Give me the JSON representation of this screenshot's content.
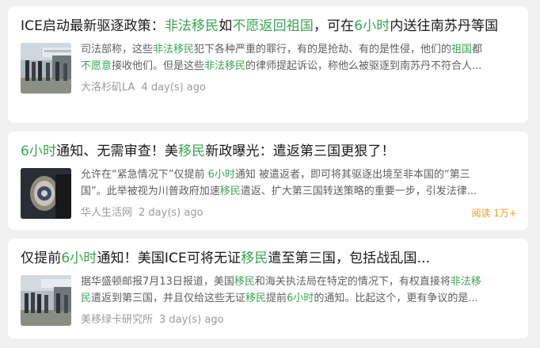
{
  "articles": [
    {
      "title_parts": [
        {
          "t": "ICE启动最新驱逐政策："
        },
        {
          "t": "非法移民",
          "h": true
        },
        {
          "t": "如"
        },
        {
          "t": "不愿返回祖国",
          "h": true
        },
        {
          "t": "，可在"
        },
        {
          "t": "6小时",
          "h": true
        },
        {
          "t": "内送往南苏丹等国"
        }
      ],
      "summary_line1": [
        {
          "t": "司法部称，这些"
        },
        {
          "t": "非法移民",
          "h": true
        },
        {
          "t": "犯下各种严重的罪行，有的是抢劫、有的是性侵，他们的"
        },
        {
          "t": "祖国",
          "h": true
        },
        {
          "t": "都"
        }
      ],
      "summary_line2": [
        {
          "t": "不愿意",
          "h": true
        },
        {
          "t": "接收他们。但是这些"
        },
        {
          "t": "非法移民",
          "h": true
        },
        {
          "t": "的律师提起诉讼，称他么被驱逐到南苏丹不符合人..."
        }
      ],
      "source": "大洛杉矶LA",
      "time": "4 day(s) ago",
      "reads": ""
    },
    {
      "title_parts": [
        {
          "t": "6小时",
          "h": true
        },
        {
          "t": "通知、无需审查！美"
        },
        {
          "t": "移民",
          "h": true
        },
        {
          "t": "新政曝光：遣返第三国更狠了！"
        }
      ],
      "summary_line1": [
        {
          "t": "允许在“紧急情况下”仅提前 "
        },
        {
          "t": "6小时",
          "h": true
        },
        {
          "t": "通知 被遣返者，即可将其驱逐出境至非本国的“第三"
        }
      ],
      "summary_line2": [
        {
          "t": "国”。此举被视为川普政府加速"
        },
        {
          "t": "移民",
          "h": true
        },
        {
          "t": "遣返、扩大第三国转送策略的重要一步，引发法律..."
        }
      ],
      "source": "华人生活网",
      "time": "2 day(s) ago",
      "reads": "阅读 1万+"
    },
    {
      "title_parts": [
        {
          "t": "仅提前"
        },
        {
          "t": "6小时",
          "h": true
        },
        {
          "t": "通知！美国ICE可将无证"
        },
        {
          "t": "移民",
          "h": true
        },
        {
          "t": "遣至第三国，包括战乱国..."
        }
      ],
      "summary_line1": [
        {
          "t": "据华盛顿邮报7月13日报道，美国"
        },
        {
          "t": "移民",
          "h": true
        },
        {
          "t": "和海关执法局在特定的情况下，有权直接将"
        },
        {
          "t": "非法移",
          "h": true
        }
      ],
      "summary_line2": [
        {
          "t": "民",
          "h": true
        },
        {
          "t": "遣返到第三国，并且仅给这些无证"
        },
        {
          "t": "移民",
          "h": true
        },
        {
          "t": "提前"
        },
        {
          "t": "6小时",
          "h": true
        },
        {
          "t": "的通知。比起这个，更有争议的是..."
        }
      ],
      "source": "美移绿卡研究所",
      "time": "3 day(s) ago",
      "reads": ""
    }
  ],
  "colors": {
    "highlight": "#3aa651",
    "reads": "#f29b1d",
    "background": "#f0f0f0"
  },
  "icons": [
    "deportation-photo-thumbnail",
    "ice-badge-thumbnail",
    "deportation-photo-thumbnail"
  ]
}
